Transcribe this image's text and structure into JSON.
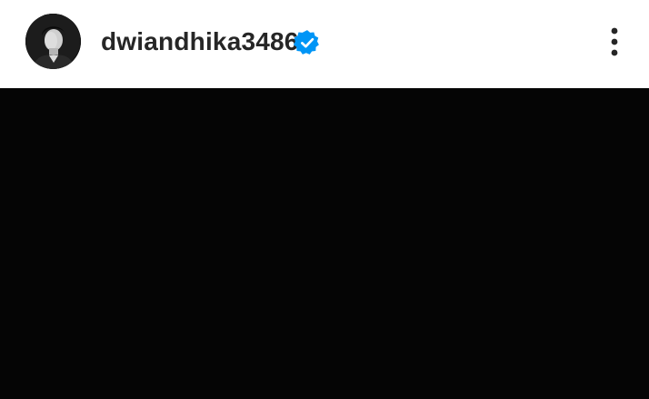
{
  "post": {
    "username": "dwiandhika3486",
    "verified": true
  },
  "icons": {
    "verified": "verified-badge-icon",
    "more": "more-options-icon",
    "avatar": "profile-photo"
  },
  "colors": {
    "verified_blue": "#0095f6",
    "media_background": "#050505",
    "text": "#262626"
  }
}
